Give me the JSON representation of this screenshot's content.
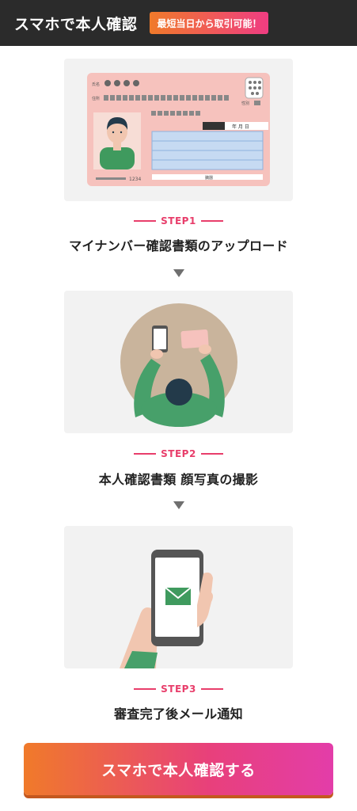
{
  "header": {
    "title": "スマホで本人確認",
    "badge": "最短当日から取引可能！"
  },
  "steps": [
    {
      "label": "STEP1",
      "title": "マイナンバー確認書類のアップロード"
    },
    {
      "label": "STEP2",
      "title": "本人確認書類 顔写真の撮影"
    },
    {
      "label": "STEP3",
      "title": "審査完了後メール通知"
    }
  ],
  "card_illustration": {
    "name_label": "氏名",
    "address_label": "住所",
    "sex_label": "性別",
    "date_label": "年 月 日",
    "number": "1234",
    "footer_label": "臓器"
  },
  "cta": {
    "label": "スマホで本人確認する"
  },
  "colors": {
    "accent": "#e83e6b",
    "header_bg": "#2b2b2b",
    "cta_start": "#f07a2a",
    "cta_end": "#e33da9"
  }
}
